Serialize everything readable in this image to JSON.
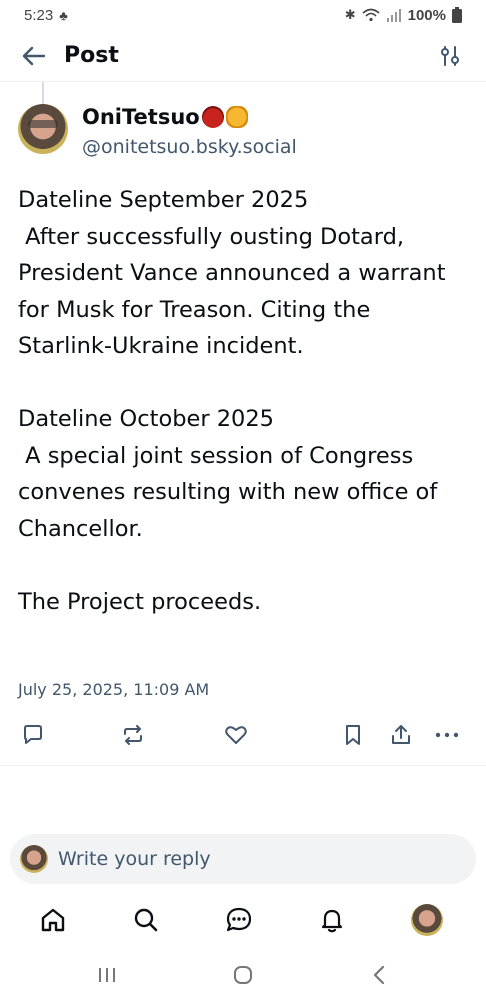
{
  "status_bar": {
    "time": "5:23",
    "battery": "100%",
    "icons": [
      "notification-icon",
      "bluetooth-icon",
      "wifi-icon",
      "signal-icon",
      "battery-icon"
    ]
  },
  "header": {
    "title": "Post",
    "back_icon": "back-arrow-icon",
    "filter_icon": "sliders-icon"
  },
  "post": {
    "author": {
      "display_name": "OniTetsuo",
      "emojis": [
        "ogre-emoji",
        "raised-fist-emoji"
      ],
      "handle": "@onitetsuo.bsky.social"
    },
    "paragraphs": [
      [
        "Dateline September 2025",
        " After successfully ousting Dotard, President Vance announced a warrant for Musk for Treason. Citing the Starlink-Ukraine incident."
      ],
      [
        "Dateline October 2025",
        " A special joint session of Congress convenes resulting with new office of Chancellor."
      ],
      [
        "The Project proceeds."
      ]
    ],
    "timestamp": "July 25, 2025, 11:09 AM",
    "actions": [
      "reply-icon",
      "repost-icon",
      "like-icon",
      "bookmark-icon",
      "share-icon",
      "more-icon"
    ]
  },
  "reply_box": {
    "placeholder": "Write your reply"
  },
  "tab_bar": [
    "home-icon",
    "search-icon",
    "chat-icon",
    "notifications-icon",
    "profile-avatar"
  ],
  "android_nav": [
    "recents-icon",
    "home-circle-icon",
    "back-icon"
  ],
  "colors": {
    "text": "#0b0f14",
    "muted": "#42576c",
    "accent": "#1083fe",
    "divider": "#eceff2"
  }
}
